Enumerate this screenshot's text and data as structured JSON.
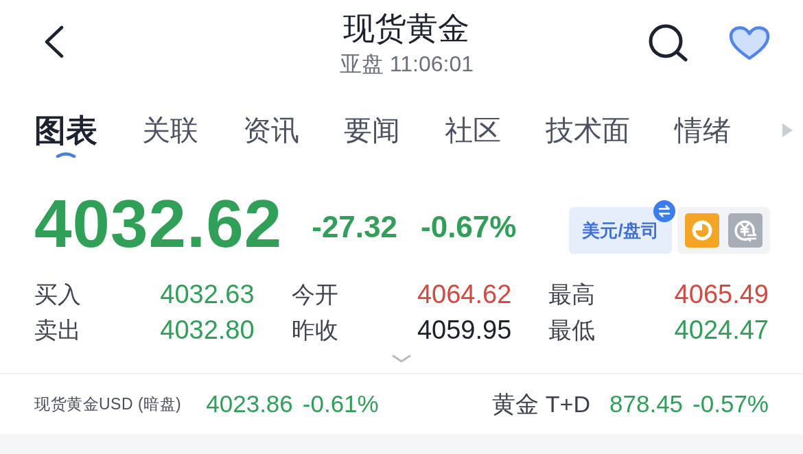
{
  "header": {
    "title": "现货黄金",
    "subtitle": "亚盘 11:06:01",
    "favorited": true
  },
  "tabs": [
    {
      "label": "图表",
      "selected": true
    },
    {
      "label": "关联",
      "selected": false
    },
    {
      "label": "资讯",
      "selected": false
    },
    {
      "label": "要闻",
      "selected": false
    },
    {
      "label": "社区",
      "selected": false
    },
    {
      "label": "技术面",
      "selected": false
    },
    {
      "label": "情绪",
      "selected": false
    }
  ],
  "quote": {
    "price": "4032.62",
    "change": "-27.32",
    "change_percent": "-0.67%",
    "color": "#30a058",
    "unit": "美元/盘司",
    "tools": [
      {
        "kind": "timer",
        "on": true
      },
      {
        "kind": "exchange",
        "on": false
      }
    ]
  },
  "stats": [
    {
      "label": "买入",
      "value": "4032.63",
      "color": "#30a058"
    },
    {
      "label": "今开",
      "value": "4064.62",
      "color": "#d6493f"
    },
    {
      "label": "最高",
      "value": "4065.49",
      "color": "#d6493f"
    },
    {
      "label": "卖出",
      "value": "4032.80",
      "color": "#30a058"
    },
    {
      "label": "昨收",
      "value": "4059.95",
      "color": "#1c2230"
    },
    {
      "label": "最低",
      "value": "4024.47",
      "color": "#30a058"
    }
  ],
  "stats_expanded": false,
  "related": [
    {
      "name": "现货黄金USD (暗盘)",
      "price": "4023.86",
      "change_percent": "-0.61%",
      "color": "#30a058"
    },
    {
      "name": "黄金 T+D",
      "price": "878.45",
      "change_percent": "-0.57%",
      "color": "#30a058"
    }
  ]
}
